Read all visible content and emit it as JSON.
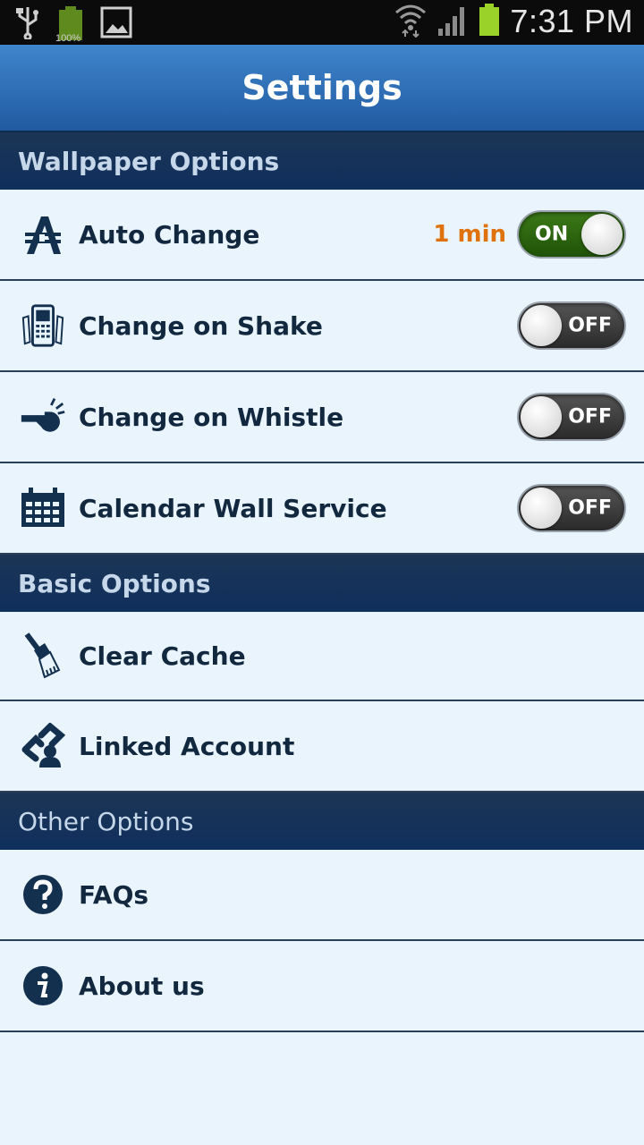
{
  "status": {
    "battery_small": "100%",
    "time": "7:31 PM"
  },
  "header": {
    "title": "Settings"
  },
  "sections": {
    "wallpaper": "Wallpaper Options",
    "basic": "Basic Options",
    "other": "Other Options"
  },
  "wallpaper_items": [
    {
      "label": "Auto Change",
      "interval": "1 min",
      "toggle": "ON"
    },
    {
      "label": "Change on Shake",
      "toggle": "OFF"
    },
    {
      "label": "Change on Whistle",
      "toggle": "OFF"
    },
    {
      "label": "Calendar Wall Service",
      "toggle": "OFF"
    }
  ],
  "basic_items": [
    {
      "label": "Clear Cache"
    },
    {
      "label": "Linked Account"
    }
  ],
  "other_items": [
    {
      "label": "FAQs"
    },
    {
      "label": "About us"
    }
  ],
  "colors": {
    "accent": "#e0720e",
    "header": "#2f6fb8",
    "section": "#122f55",
    "toggle_on": "#2f6a12"
  }
}
